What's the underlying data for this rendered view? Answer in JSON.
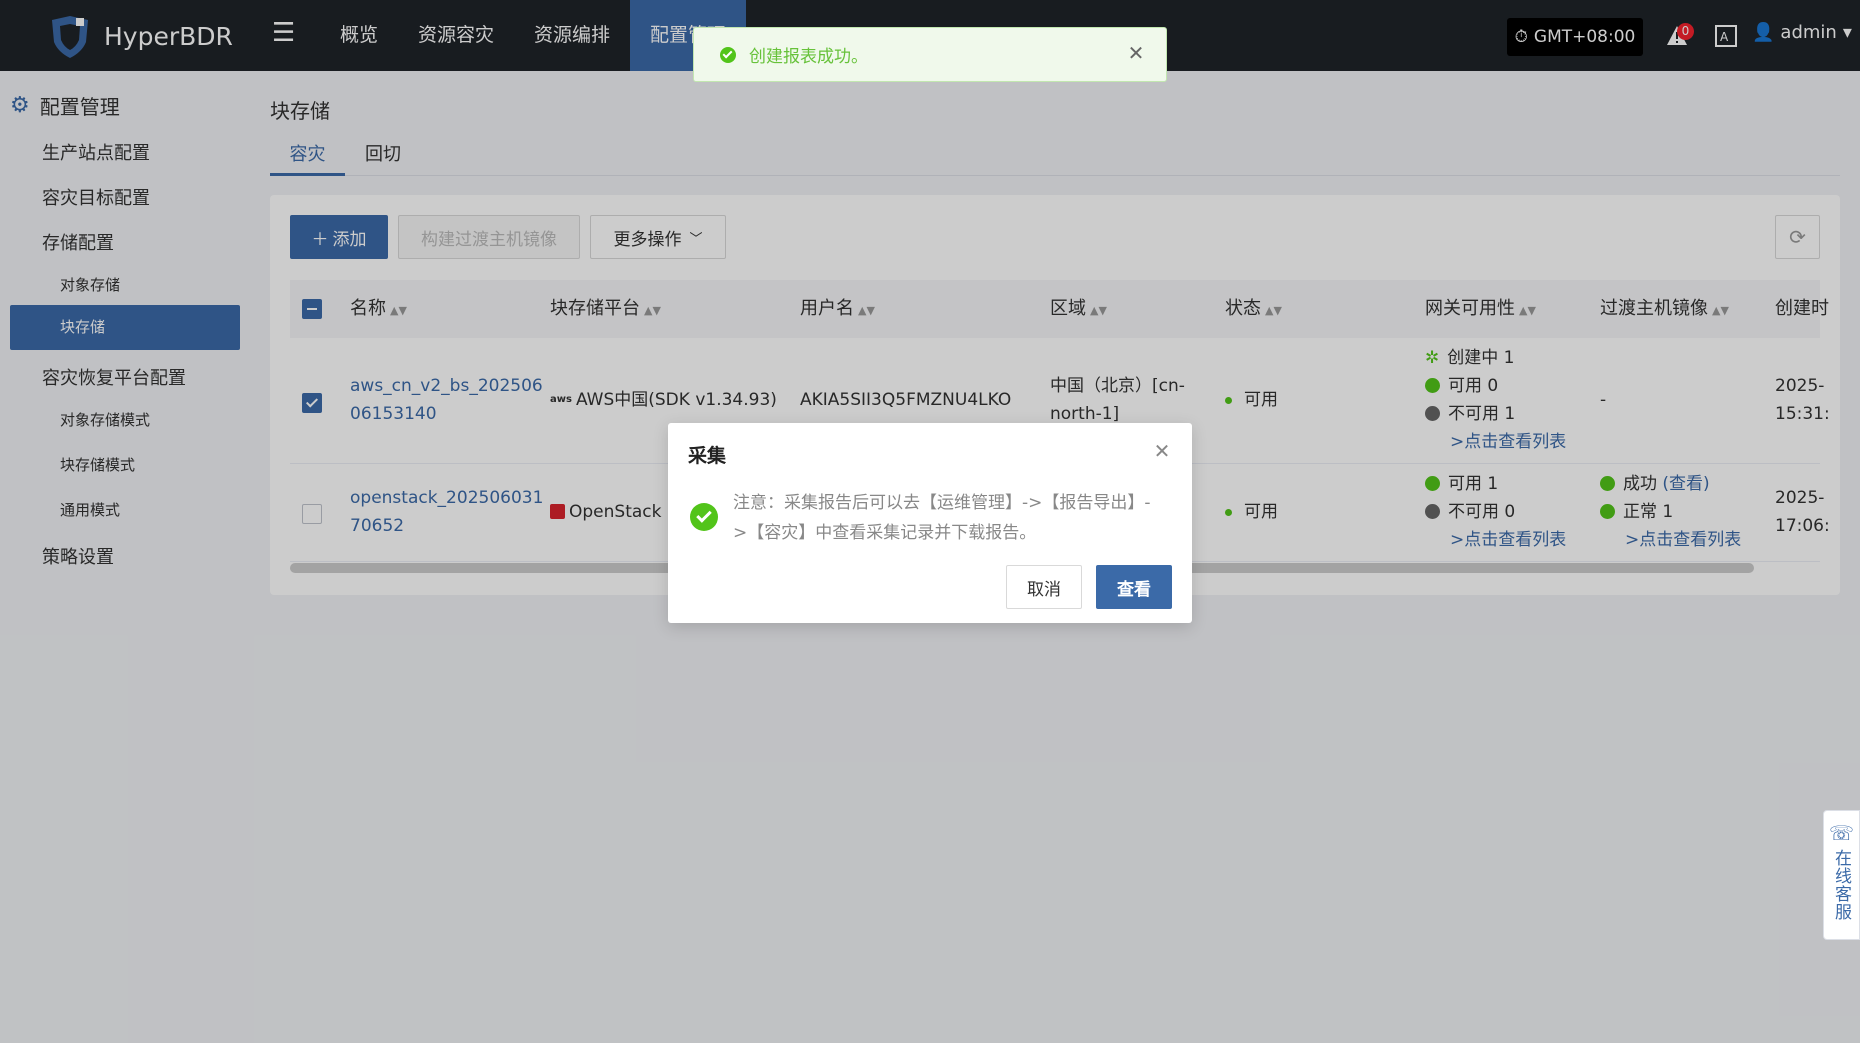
{
  "header": {
    "app_name": "HyperBDR",
    "nav": [
      "概览",
      "资源容灾",
      "资源编排",
      "配置管理"
    ],
    "timezone": "GMT+08:00",
    "alert_count": "0",
    "user": "admin"
  },
  "sidebar": {
    "title": "配置管理",
    "items": [
      "生产站点配置",
      "容灾目标配置",
      "存储配置",
      "对象存储",
      "块存储",
      "容灾恢复平台配置",
      "对象存储模式",
      "块存储模式",
      "通用模式",
      "策略设置"
    ]
  },
  "page": {
    "title": "块存储",
    "tabs": [
      "容灾",
      "回切"
    ]
  },
  "toolbar": {
    "add": "添加",
    "build_image": "构建过渡主机镜像",
    "more": "更多操作"
  },
  "table": {
    "headers": [
      "名称",
      "块存储平台",
      "用户名",
      "区域",
      "状态",
      "网关可用性",
      "过渡主机镜像",
      "创建时"
    ],
    "rows": [
      {
        "name_line1": "aws_cn_v2_bs_202506",
        "name_line2": "06153140",
        "platform": "AWS中国(SDK v1.34.93)",
        "platform_icon": "aws",
        "username": "AKIA5SII3Q5FMZNU4LKO",
        "region_line1": "中国（北京）[cn-",
        "region_line2": "north-1]",
        "status": "可用",
        "gateway": [
          "创建中 1",
          "可用 0",
          "不可用 1"
        ],
        "gateway_link": ">点击查看列表",
        "image": "-",
        "created_line1": "2025-",
        "created_line2": "15:31:"
      },
      {
        "name_line1": "openstack_202506031",
        "name_line2": "70652",
        "platform": "OpenStack",
        "status": "可用",
        "gateway": [
          "可用 1",
          "不可用 0"
        ],
        "gateway_link": ">点击查看列表",
        "image_success": "成功",
        "image_view": "(查看)",
        "image_normal": "正常 1",
        "image_link": ">点击查看列表",
        "created_line1": "2025-",
        "created_line2": "17:06:"
      }
    ]
  },
  "dialog": {
    "title": "采集",
    "message": "注意：采集报告后可以去【运维管理】->【报告导出】->【容灾】中查看采集记录并下载报告。",
    "cancel": "取消",
    "ok": "查看"
  },
  "toast": {
    "message": "创建报表成功。"
  },
  "support": {
    "label": "在线客服"
  },
  "colors": {
    "primary": "#3b6aa8",
    "header_bg": "#1f2329",
    "success": "#52c41a"
  }
}
